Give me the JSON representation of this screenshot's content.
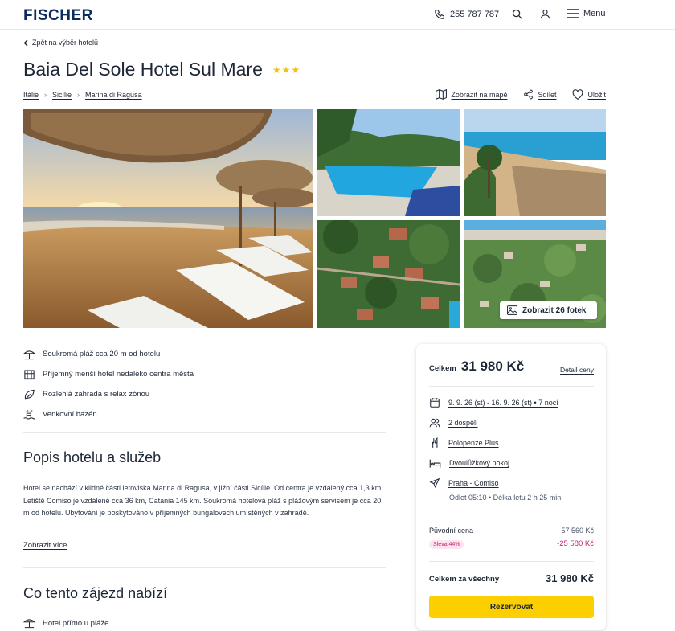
{
  "header": {
    "logo": "FISCHER",
    "phone": "255 787 787",
    "menu_label": "Menu",
    "icons": [
      "phone-icon",
      "search-icon",
      "user-icon",
      "menu-icon"
    ]
  },
  "back_link": "Zpět na výběr hotelů",
  "hotel": {
    "name": "Baia Del Sole Hotel Sul Mare",
    "stars": "★★★"
  },
  "breadcrumbs": [
    "Itálie",
    "Sicílie",
    "Marina di Ragusa"
  ],
  "actions": {
    "map": "Zobrazit na mapě",
    "share": "Sdílet",
    "save": "Uložit"
  },
  "gallery": {
    "show_photos": "Zobrazit 26 fotek"
  },
  "features": [
    {
      "icon": "beach-umbrella-icon",
      "text": "Soukromá pláž cca 20 m od hotelu"
    },
    {
      "icon": "building-icon",
      "text": "Příjemný menší hotel nedaleko centra města"
    },
    {
      "icon": "leaf-icon",
      "text": "Rozlehlá zahrada s relax zónou"
    },
    {
      "icon": "pool-icon",
      "text": "Venkovní bazén"
    }
  ],
  "description": {
    "heading": "Popis hotelu a služeb",
    "text": "Hotel se nachází v klidné části letoviska Marina di Ragusa, v jižní části Sicílie. Od centra je vzdálený cca 1,3 km. Letiště Comiso je vzdálené cca 36 km, Catania 145 km. Soukromá hotelová pláž s plážovým servisem je cca 20 m od hotelu. Ubytování je poskytováno v příjemných bungalovech umístěných v zahradě.",
    "more": "Zobrazit více"
  },
  "offer": {
    "heading": "Co tento zájezd nabízí",
    "items": [
      "Hotel přímo u pláže"
    ]
  },
  "booking": {
    "total_label": "Celkem",
    "total_value": "31 980 Kč",
    "detail_link": "Detail ceny",
    "dates": "9. 9. 26 (st) - 16. 9. 26 (st) • 7 nocí",
    "persons": "2 dospělí",
    "board": "Polopenze Plus",
    "room": "Dvoulůžkový pokoj",
    "flight": "Praha - Comiso",
    "flight_info": "Odlet 05:10 • Délka letu 2 h 25 min",
    "original_label": "Původní cena",
    "original_value": "57 560 Kč",
    "discount_badge": "Sleva 44%",
    "discount_value": "-25 580 Kč",
    "total_all_label": "Celkem za všechny",
    "total_all_value": "31 980 Kč",
    "reserve_button": "Rezervovat"
  }
}
